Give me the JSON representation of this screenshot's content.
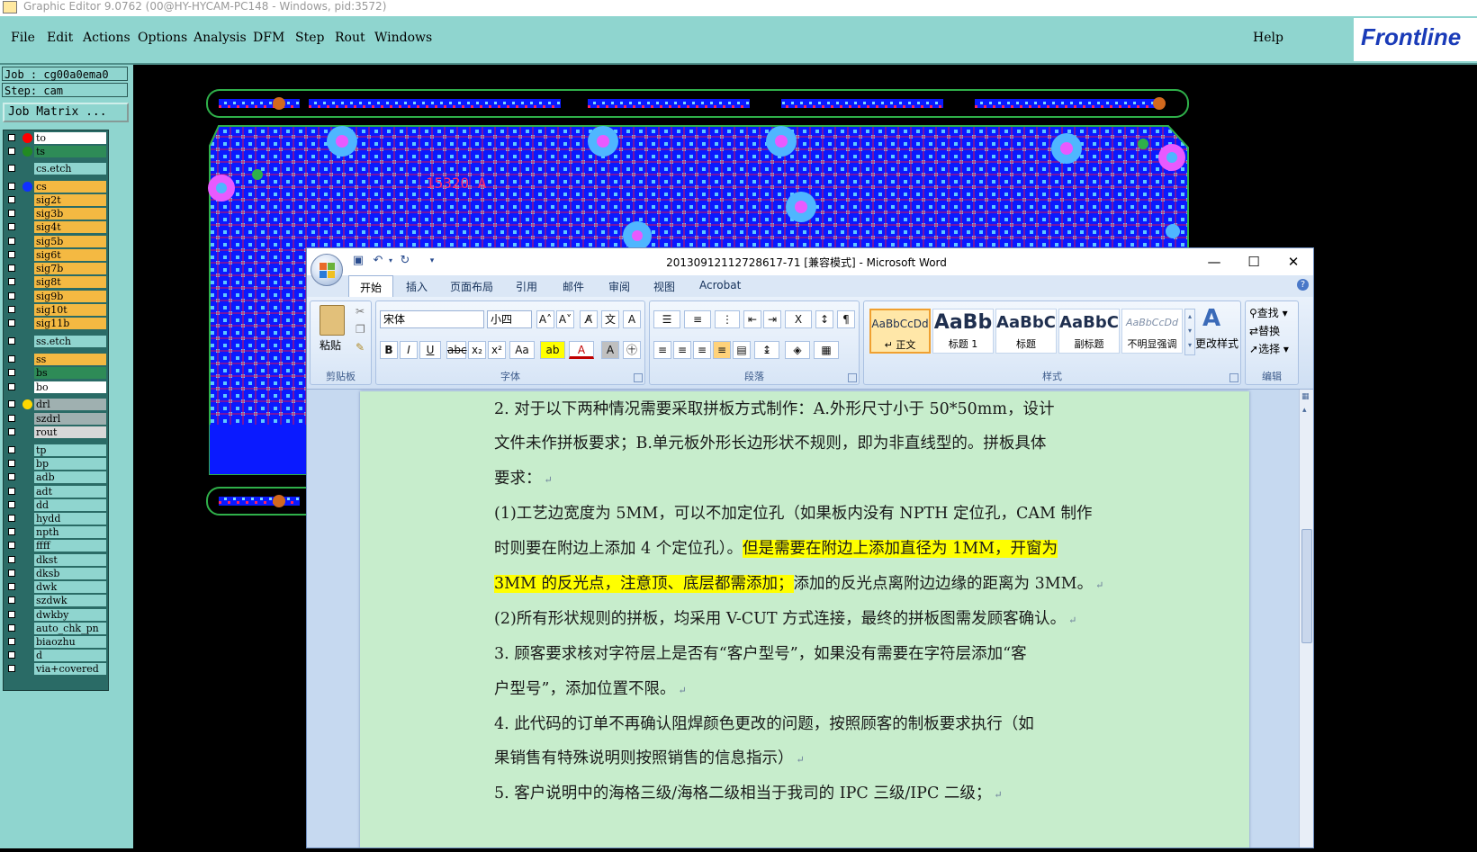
{
  "editor": {
    "title": "Graphic Editor 9.0762 (00@HY-HYCAM-PC148 - Windows, pid:3572)",
    "menus": [
      "File",
      "Edit",
      "Actions",
      "Options",
      "Analysis",
      "DFM",
      "Step",
      "Rout",
      "Windows"
    ],
    "help": "Help",
    "logo": "Frontline",
    "job_line": "Job : cg00a0ema0",
    "step_line": "Step: cam",
    "job_matrix_button": "Job Matrix ...",
    "layers": [
      {
        "name": "to",
        "bg": "#ffffff",
        "dot": "#ff0000"
      },
      {
        "name": "ts",
        "bg": "#2e8b57",
        "dot": "#228b22"
      },
      {
        "name": "cs.etch",
        "bg": "#8fd5cf"
      },
      {
        "name": "cs",
        "bg": "#f4b942",
        "dot": "#1030ff"
      },
      {
        "name": "sig2t",
        "bg": "#f4b942"
      },
      {
        "name": "sig3b",
        "bg": "#f4b942"
      },
      {
        "name": "sig4t",
        "bg": "#f4b942"
      },
      {
        "name": "sig5b",
        "bg": "#f4b942"
      },
      {
        "name": "sig6t",
        "bg": "#f4b942"
      },
      {
        "name": "sig7b",
        "bg": "#f4b942"
      },
      {
        "name": "sig8t",
        "bg": "#f4b942"
      },
      {
        "name": "sig9b",
        "bg": "#f4b942"
      },
      {
        "name": "sig10t",
        "bg": "#f4b942"
      },
      {
        "name": "sig11b",
        "bg": "#f4b942"
      },
      {
        "name": "ss.etch",
        "bg": "#8fd5cf"
      },
      {
        "name": "ss",
        "bg": "#f4b942"
      },
      {
        "name": "bs",
        "bg": "#2e8b57"
      },
      {
        "name": "bo",
        "bg": "#ffffff"
      },
      {
        "name": "drl",
        "bg": "#9fb0b0",
        "dot": "#ffd700"
      },
      {
        "name": "szdrl",
        "bg": "#9fb0b0"
      },
      {
        "name": "rout",
        "bg": "#d8d8d8"
      },
      {
        "name": "tp",
        "bg": "#8fd5cf"
      },
      {
        "name": "bp",
        "bg": "#8fd5cf"
      },
      {
        "name": "adb",
        "bg": "#8fd5cf"
      },
      {
        "name": "adt",
        "bg": "#8fd5cf"
      },
      {
        "name": "dd",
        "bg": "#8fd5cf"
      },
      {
        "name": "hydd",
        "bg": "#8fd5cf"
      },
      {
        "name": "npth",
        "bg": "#8fd5cf"
      },
      {
        "name": "ffff",
        "bg": "#8fd5cf"
      },
      {
        "name": "dkst",
        "bg": "#8fd5cf"
      },
      {
        "name": "dksb",
        "bg": "#8fd5cf"
      },
      {
        "name": "dwk",
        "bg": "#8fd5cf"
      },
      {
        "name": "szdwk",
        "bg": "#8fd5cf"
      },
      {
        "name": "dwkby",
        "bg": "#8fd5cf"
      },
      {
        "name": "auto_chk_pn",
        "bg": "#8fd5cf"
      },
      {
        "name": "biaozhu",
        "bg": "#8fd5cf"
      },
      {
        "name": "d",
        "bg": "#8fd5cf"
      },
      {
        "name": "via+covered",
        "bg": "#8fd5cf"
      }
    ],
    "board_label": "15320 A"
  },
  "word": {
    "title": "20130912112728617-71 [兼容模式] - Microsoft Word",
    "tabs": [
      "开始",
      "插入",
      "页面布局",
      "引用",
      "邮件",
      "审阅",
      "视图",
      "Acrobat"
    ],
    "groups": {
      "clipboard": "剪贴板",
      "paste": "粘贴",
      "font": "字体",
      "paragraph": "段落",
      "styles": "样式",
      "editing": "编辑"
    },
    "font_name": "宋体",
    "font_size": "小四",
    "style_items": [
      {
        "preview": "AaBbCcDd",
        "label": "↵ 正文"
      },
      {
        "preview": "AaBb",
        "label": "标题 1"
      },
      {
        "preview": "AaBbC",
        "label": "标题"
      },
      {
        "preview": "AaBbC",
        "label": "副标题"
      },
      {
        "preview": "AaBbCcDd",
        "label": "不明显强调"
      }
    ],
    "change_styles": "更改样式",
    "find": "查找 ▾",
    "replace": "替换",
    "select": "选择 ▾",
    "lines": [
      [
        {
          "t": "2.  对于以下两种情况需要采取拼板方式制作：A.外形尺寸小于  50*50mm，设计"
        }
      ],
      [
        {
          "t": "文件未作拼板要求；B.单元板外形长边形状不规则，即为非直线型的。拼板具体"
        }
      ],
      [
        {
          "t": "要求："
        },
        {
          "t": "↵",
          "pm": true
        }
      ],
      [
        {
          "t": "(1)工艺边宽度为 5MM，可以不加定位孔（如果板内没有 NPTH 定位孔，CAM 制作"
        }
      ],
      [
        {
          "t": "时则要在附边上添加 4 个定位孔）。"
        },
        {
          "t": "但是需要在附边上添加直径为 1MM，开窗为",
          "hl": true
        }
      ],
      [
        {
          "t": "3MM 的反光点，注意顶、底层都需添加；",
          "hl": true
        },
        {
          "t": "添加的反光点离附边边缘的距离为 3MM。"
        },
        {
          "t": "↵",
          "pm": true
        }
      ],
      [
        {
          "t": "(2)所有形状规则的拼板，均采用 V-CUT 方式连接，最终的拼板图需发顾客确认。"
        },
        {
          "t": "↵",
          "pm": true
        }
      ],
      [
        {
          "t": "3.  顾客要求核对字符层上是否有“客户型号”，如果没有需要在字符层添加“客"
        }
      ],
      [
        {
          "t": "户型号”，添加位置不限。"
        },
        {
          "t": "↵",
          "pm": true
        }
      ],
      [
        {
          "t": "4.  此代码的订单不再确认阻焊颜色更改的问题，按照顾客的制板要求执行（如"
        }
      ],
      [
        {
          "t": "果销售有特殊说明则按照销售的信息指示）"
        },
        {
          "t": "↵",
          "pm": true
        }
      ],
      [
        {
          "t": "5.  客户说明中的海格三级/海格二级相当于我司的 IPC 三级/IPC 二级；"
        },
        {
          "t": "↵",
          "pm": true
        }
      ]
    ]
  }
}
